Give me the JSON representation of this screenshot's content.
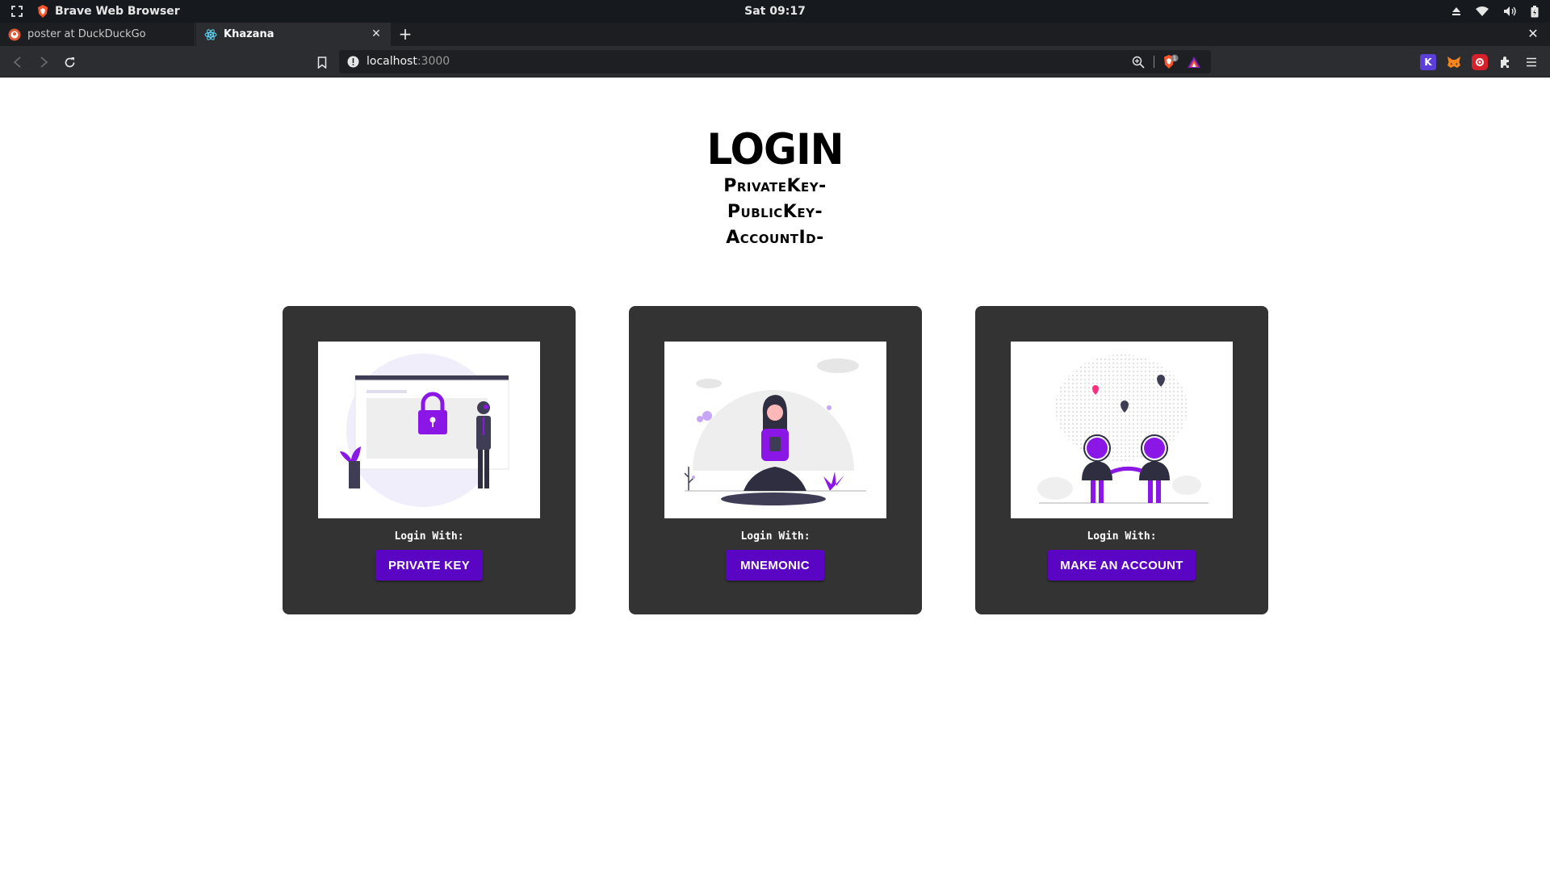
{
  "os": {
    "app_name": "Brave Web Browser",
    "clock": "Sat 09:17"
  },
  "tabs": [
    {
      "title": "poster at DuckDuckGo",
      "active": false
    },
    {
      "title": "Khazana",
      "active": true
    }
  ],
  "toolbar": {
    "url_host": "localhost",
    "url_port": ":3000",
    "shields_count": "1",
    "extensions": [
      "K"
    ]
  },
  "page": {
    "title": "LOGIN",
    "subtitle_lines": [
      "PrivateKey-",
      "PublicKey-",
      "AccountId-"
    ]
  },
  "cards": [
    {
      "caption": "Login With:",
      "button": "PRIVATE KEY"
    },
    {
      "caption": "Login With:",
      "button": "MNEMONIC"
    },
    {
      "caption": "Login With:",
      "button": "MAKE AN ACCOUNT"
    }
  ],
  "colors": {
    "accent": "#5a05c4",
    "card_bg": "#333333",
    "illustration_purple": "#8a17e6"
  }
}
